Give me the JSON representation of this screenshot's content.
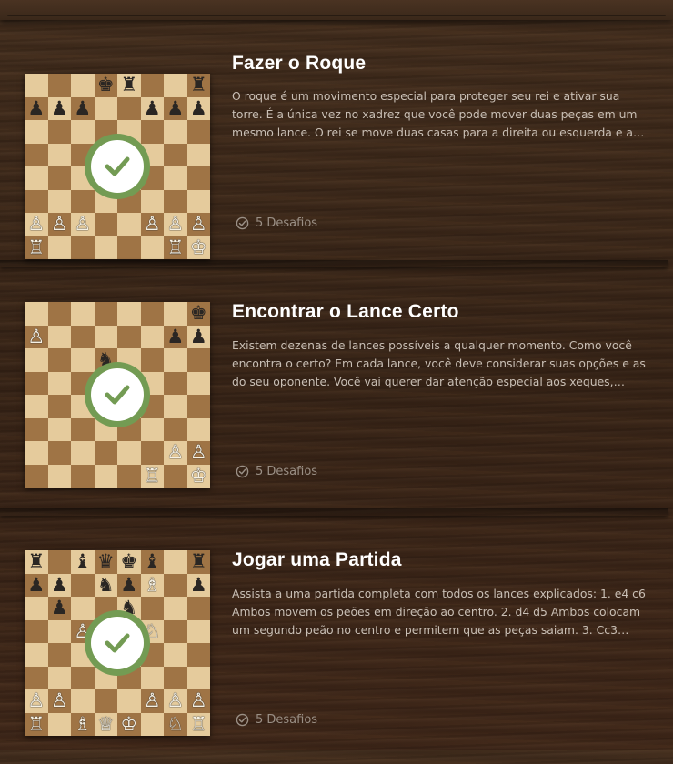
{
  "colors": {
    "accent_green": "#739b53",
    "board_light": "#e5cb9c",
    "board_dark": "#9f7445"
  },
  "lessons": [
    {
      "title": "Fazer o Roque",
      "description": "O roque é um movimento especial para proteger seu rei e ativar sua torre. É a única vez no xadrez que você pode mover duas peças em um mesmo lance. O rei se move duas casas para a direita ou esquerda e a…",
      "challenges": "5 Desafios",
      "completed": true,
      "icon": "check-icon",
      "board": [
        "···♚♜··♜",
        "♟♟♟··♟♟♟",
        "········",
        "········",
        "········",
        "········",
        "♙♙♙··♙♙♙",
        "♖·····♖♔"
      ],
      "_board_note": "unused"
    },
    {
      "title": "Encontrar o Lance Certo",
      "description": "Existem dezenas de lances possíveis a qualquer momento. Como você encontra o certo? Em cada lance, você deve considerar suas opções e as do seu oponente. Você vai querer dar atenção especial aos xeques,…",
      "challenges": "5 Desafios",
      "completed": true,
      "icon": "check-icon",
      "board": [
        "·······♚",
        "♙·····♟♟",
        "···♞····",
        "········",
        "········",
        "········",
        "······♙♙",
        "·····♖·♔"
      ]
    },
    {
      "title": "Jogar uma Partida",
      "description": "Assista a uma partida completa com todos os lances explicados: 1. e4 c6 Ambos movem os peões em direção ao centro. 2. d4 d5 Ambos colocam um segundo peão no centro e permitem que as peças saiam. 3. Cc3…",
      "challenges": "5 Desafios",
      "completed": true,
      "icon": "check-icon",
      "board": [
        "♜·♝♛♚♝·♜",
        "♟♟·♞♟♗·♟",
        "·♟··♞···",
        "··♙··♘··",
        "········",
        "········",
        "♙♙···♙♙♙",
        "♖·♗♕♔·♘♖"
      ]
    }
  ]
}
